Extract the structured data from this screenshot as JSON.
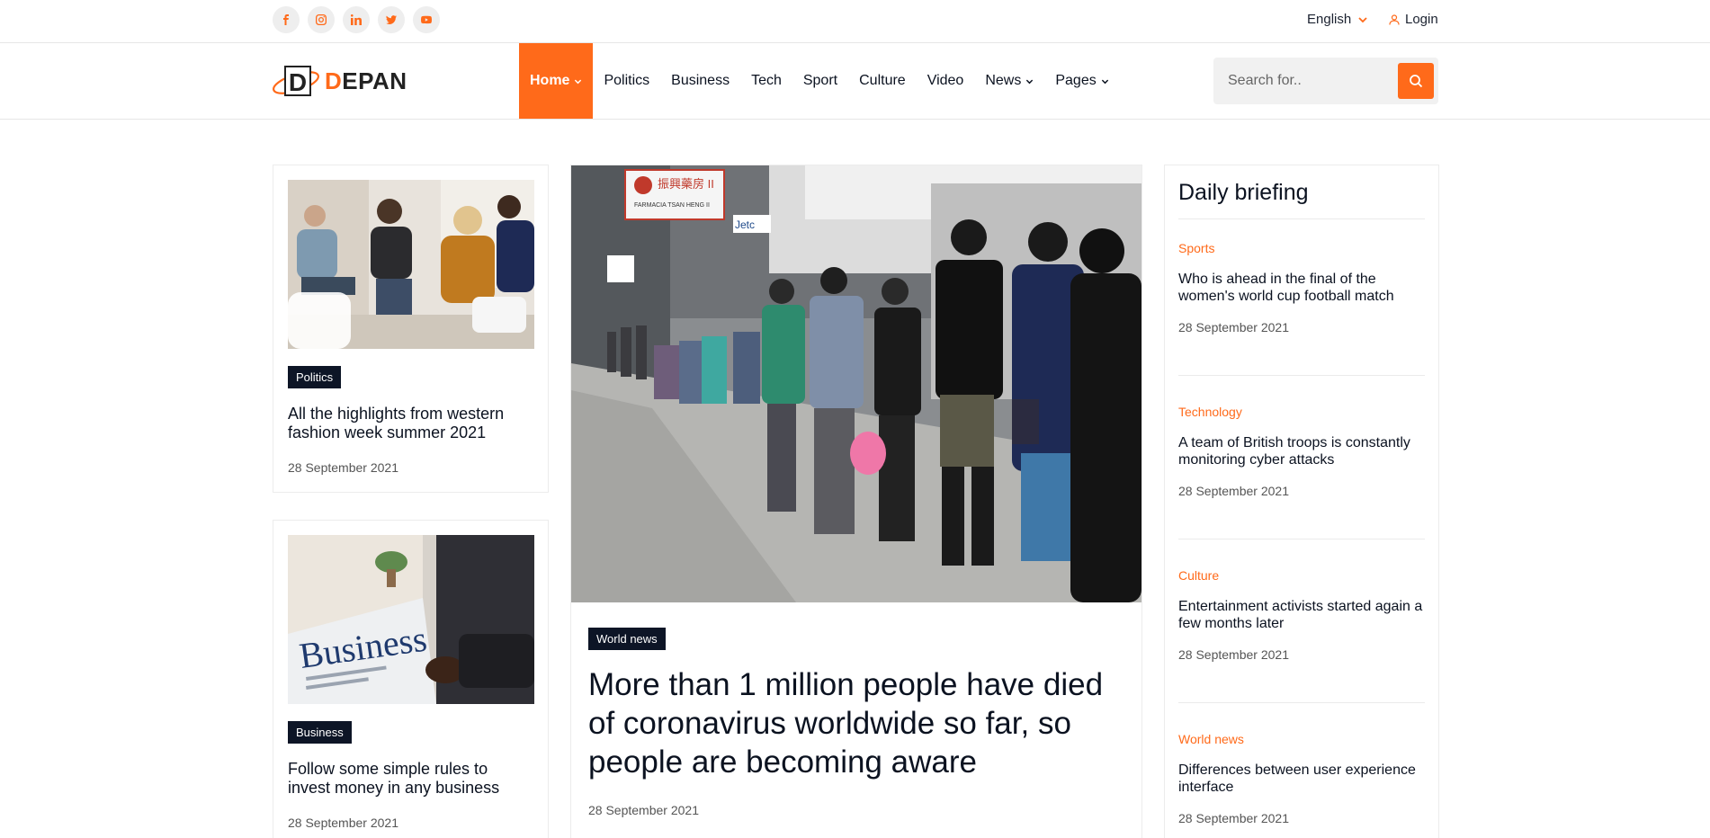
{
  "topbar": {
    "socials": [
      {
        "icon": "facebook-icon",
        "glyph": "f"
      },
      {
        "icon": "instagram-icon",
        "glyph": "◎"
      },
      {
        "icon": "linkedin-icon",
        "glyph": "in"
      },
      {
        "icon": "twitter-icon",
        "glyph": "t"
      },
      {
        "icon": "youtube-icon",
        "glyph": "▶"
      }
    ],
    "language": "English",
    "login": "Login"
  },
  "brand": {
    "name_d": "D",
    "name_rest": "EPAN",
    "name_o": ""
  },
  "nav": {
    "items": [
      {
        "label": "Home",
        "dropdown": true,
        "active": true
      },
      {
        "label": "Politics",
        "dropdown": false
      },
      {
        "label": "Business",
        "dropdown": false
      },
      {
        "label": "Tech",
        "dropdown": false
      },
      {
        "label": "Sport",
        "dropdown": false
      },
      {
        "label": "Culture",
        "dropdown": false
      },
      {
        "label": "Video",
        "dropdown": false
      },
      {
        "label": "News",
        "dropdown": true
      },
      {
        "label": "Pages",
        "dropdown": true
      }
    ]
  },
  "search": {
    "placeholder": "Search for.."
  },
  "left_cards": [
    {
      "tag": "Politics",
      "title": "All the highlights from western fashion week summer 2021",
      "date": "28 September 2021"
    },
    {
      "tag": "Business",
      "title": "Follow some simple rules to invest money in any business",
      "date": "28 September 2021"
    }
  ],
  "featured": {
    "tag": "World news",
    "title": "More than 1 million people have died of coronavirus worldwide so far, so people are becoming aware",
    "date": "28 September 2021",
    "sign_text": "振興藥房 II",
    "sign_sub": "FARMACIA TSAN HENG II"
  },
  "briefing": {
    "heading": "Daily briefing",
    "items": [
      {
        "category": "Sports",
        "title": "Who is ahead in the final of the women's world cup football match",
        "date": "28 September 2021"
      },
      {
        "category": "Technology",
        "title": "A team of British troops is constantly monitoring cyber attacks",
        "date": "28 September 2021"
      },
      {
        "category": "Culture",
        "title": "Entertainment activists started again a few months later",
        "date": "28 September 2021"
      },
      {
        "category": "World news",
        "title": "Differences between user experience interface",
        "date": "28 September 2021"
      }
    ]
  },
  "colors": {
    "accent": "#ff6a1a",
    "dark": "#0d1526"
  }
}
